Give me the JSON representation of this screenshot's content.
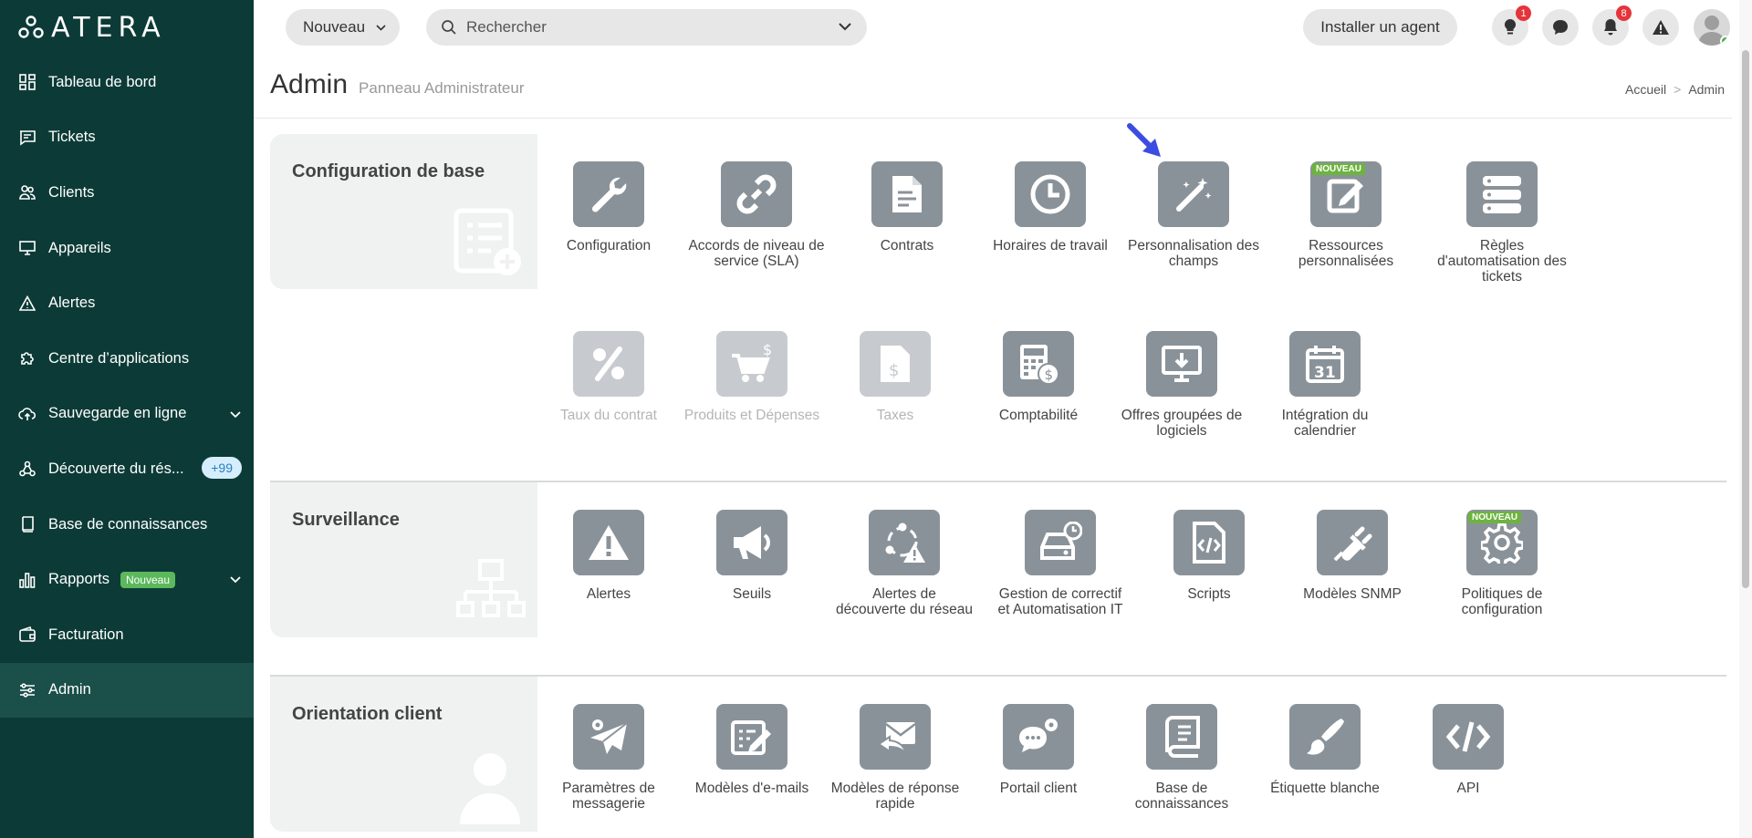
{
  "sidebar": {
    "logo": "ATERA",
    "items": [
      {
        "label": "Tableau de bord",
        "icon": "dashboard-icon"
      },
      {
        "label": "Tickets",
        "icon": "ticket-icon"
      },
      {
        "label": "Clients",
        "icon": "clients-icon"
      },
      {
        "label": "Appareils",
        "icon": "monitor-icon"
      },
      {
        "label": "Alertes",
        "icon": "alert-icon"
      },
      {
        "label": "Centre d’applications",
        "icon": "puzzle-icon"
      },
      {
        "label": "Sauvegarde en ligne",
        "icon": "cloud-icon"
      },
      {
        "label": "Découverte du rés...",
        "icon": "network-icon",
        "badge": "+99"
      },
      {
        "label": "Base de connaissances",
        "icon": "book-icon"
      },
      {
        "label": "Rapports",
        "icon": "chart-icon",
        "badge": "Nouveau"
      },
      {
        "label": "Facturation",
        "icon": "wallet-icon"
      },
      {
        "label": "Admin",
        "icon": "sliders-icon",
        "active": true
      }
    ]
  },
  "topbar": {
    "new_label": "Nouveau",
    "search_placeholder": "Rechercher",
    "install_label": "Installer un agent",
    "ideas_count": "1",
    "notifications_count": "8"
  },
  "header": {
    "title": "Admin",
    "subtitle": "Panneau Administrateur",
    "breadcrumb": [
      "Accueil",
      ">",
      "Admin"
    ]
  },
  "sections": {
    "base": {
      "title": "Configuration de base",
      "row1": [
        {
          "label": "Configuration"
        },
        {
          "label": "Accords de niveau de service (SLA)"
        },
        {
          "label": "Contrats"
        },
        {
          "label": "Horaires de travail"
        },
        {
          "label": "Personnalisation des champs"
        },
        {
          "label": "Ressources personnalisées",
          "badge": "NOUVEAU"
        },
        {
          "label": "Règles d'automatisation des tickets"
        }
      ],
      "row2": [
        {
          "label": "Taux du contrat"
        },
        {
          "label": "Produits et Dépenses"
        },
        {
          "label": "Taxes"
        },
        {
          "label": "Comptabilité"
        },
        {
          "label": "Offres groupées de logiciels"
        },
        {
          "label": "Intégration du calendrier",
          "calendar_day": "31"
        }
      ]
    },
    "surveillance": {
      "title": "Surveillance",
      "tiles": [
        {
          "label": "Alertes"
        },
        {
          "label": "Seuils"
        },
        {
          "label": "Alertes de découverte du réseau"
        },
        {
          "label": "Gestion de correctif et Automatisation IT"
        },
        {
          "label": "Scripts"
        },
        {
          "label": "Modèles SNMP"
        },
        {
          "label": "Politiques de configuration",
          "badge": "NOUVEAU"
        }
      ]
    },
    "client": {
      "title": "Orientation client",
      "tiles": [
        {
          "label": "Paramètres de messagerie"
        },
        {
          "label": "Modèles d'e-mails"
        },
        {
          "label": "Modèles de réponse rapide"
        },
        {
          "label": "Portail client"
        },
        {
          "label": "Base de connaissances"
        },
        {
          "label": "Étiquette blanche"
        },
        {
          "label": "API"
        }
      ]
    }
  }
}
